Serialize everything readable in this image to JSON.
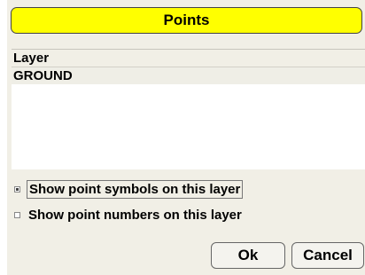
{
  "dialog": {
    "title": "Points",
    "list": {
      "header": "Layer",
      "rows": [
        "GROUND"
      ]
    },
    "options": [
      {
        "label": "Show point symbols on this layer",
        "checked": true
      },
      {
        "label": "Show point numbers on this layer",
        "checked": false
      }
    ],
    "buttons": {
      "ok": "Ok",
      "cancel": "Cancel"
    }
  },
  "colors": {
    "title_bar": "#ffff00",
    "dialog_bg": "#f1efe6"
  }
}
